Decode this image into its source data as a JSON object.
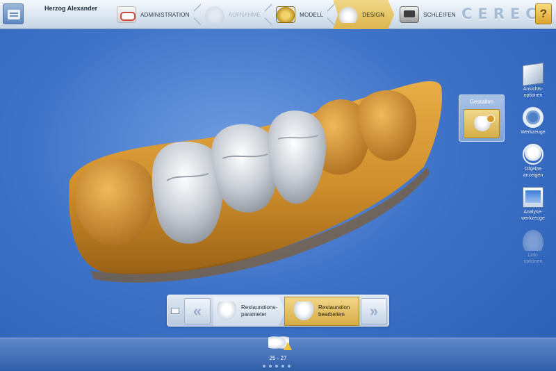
{
  "header": {
    "patient_name": "Herzog Alexander",
    "brand": "CEREC",
    "steps": [
      {
        "label": "ADMINISTRATION",
        "icon": "dental-arch-icon",
        "state": "normal"
      },
      {
        "label": "AUFNAHME",
        "icon": "acquisition-icon",
        "state": "disabled"
      },
      {
        "label": "MODELL",
        "icon": "model-icon",
        "state": "normal"
      },
      {
        "label": "DESIGN",
        "icon": "design-crown-icon",
        "state": "active"
      },
      {
        "label": "SCHLEIFEN",
        "icon": "milling-unit-icon",
        "state": "normal"
      }
    ],
    "help_label": "?"
  },
  "side_panel": {
    "gestalten_label": "Gestalten",
    "tools": [
      {
        "label_1": "Ansichts-",
        "label_2": "optionen",
        "icon": "view-cube-icon",
        "enabled": true
      },
      {
        "label_1": "Werkzeuge",
        "label_2": "",
        "icon": "tool-wheel-icon",
        "enabled": true
      },
      {
        "label_1": "Objekte",
        "label_2": "anzeigen",
        "icon": "show-objects-icon",
        "enabled": true
      },
      {
        "label_1": "Analyse-",
        "label_2": "werkzeuge",
        "icon": "analysis-icon",
        "enabled": true
      },
      {
        "label_1": "Link-",
        "label_2": "optionen",
        "icon": "link-icon",
        "enabled": false
      }
    ]
  },
  "bottom_nav": {
    "prev_icon": "double-chevron-left-icon",
    "next_icon": "double-chevron-right-icon",
    "step1_line1": "Restaurations-",
    "step1_line2": "parameter",
    "step2_line1": "Restauration",
    "step2_line2": "bearbeiten"
  },
  "tray": {
    "restoration_label": "25 - 27",
    "page_dots": 5
  },
  "colors": {
    "background": "#3f73c8",
    "active_gold": "#ddb64e",
    "model_orange": "#d79a3b"
  }
}
